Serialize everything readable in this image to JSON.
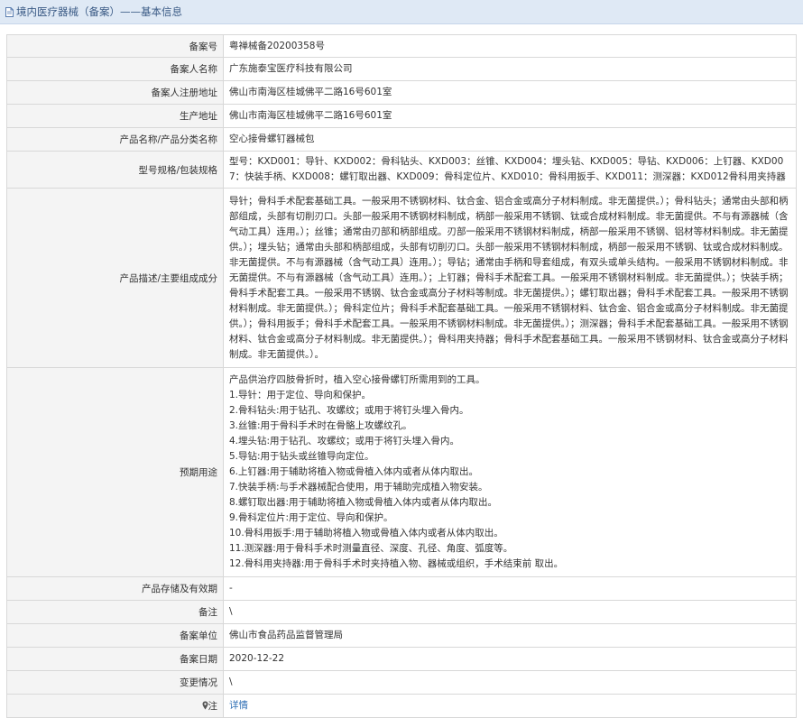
{
  "header": {
    "title": "境内医疗器械（备案）——基本信息",
    "icon": "document-icon"
  },
  "rows": [
    {
      "label": "备案号",
      "value": "粤禅械备20200358号"
    },
    {
      "label": "备案人名称",
      "value": "广东施泰宝医疗科技有限公司"
    },
    {
      "label": "备案人注册地址",
      "value": "佛山市南海区桂城佛平二路16号601室"
    },
    {
      "label": "生产地址",
      "value": "佛山市南海区桂城佛平二路16号601室"
    },
    {
      "label": "产品名称/产品分类名称",
      "value": "空心接骨螺钉器械包"
    },
    {
      "label": "型号规格/包装规格",
      "value": "型号：KXD001：导针、KXD002：骨科钻头、KXD003：丝锥、KXD004：埋头钻、KXD005：导钻、KXD006：上钉器、KXD007：快装手柄、KXD008：螺钉取出器、KXD009：骨科定位片、KXD010：骨科用扳手、KXD011：测深器：KXD012骨科用夹持器"
    },
    {
      "label": "产品描述/主要组成成分",
      "value": "导针；骨科手术配套基础工具。一般采用不锈钢材料、钛合金、铝合金或高分子材料制成。非无菌提供。）；骨科钻头；通常由头部和柄部组成，头部有切削刃口。头部一般采用不锈钢材料制成，柄部一般采用不锈钢、钛或合成材料制成。非无菌提供。不与有源器械（含气动工具）连用。）；丝锥；通常由刃部和柄部组成。刃部一般采用不锈钢材料制成，柄部一般采用不锈钢、铝材等材料制成。非无菌提供。）；埋头钻；通常由头部和柄部组成，头部有切削刃口。头部一般采用不锈钢材料制成，柄部一般采用不锈钢、钛或合成材料制成。非无菌提供。不与有源器械（含气动工具）连用。）；导钻；通常由手柄和导套组成，有双头或单头结构。一般采用不锈钢材料制成。非无菌提供。不与有源器械（含气动工具）连用。）；上钉器；骨科手术配套工具。一般采用不锈钢材料制成。非无菌提供。）；快装手柄；骨科手术配套工具。一般采用不锈钢、钛合金或高分子材料等制成。非无菌提供。）；螺钉取出器；骨科手术配套工具。一般采用不锈钢材料制成。非无菌提供。）；骨科定位片；骨科手术配套基础工具。一般采用不锈钢材料、钛合金、铝合金或高分子材料制成。非无菌提供。）；骨科用扳手；骨科手术配套工具。一般采用不锈钢材料制成。非无菌提供。）；测深器；骨科手术配套基础工具。一般采用不锈钢材料、钛合金或高分子材料制成。非无菌提供。）；骨科用夹持器；骨科手术配套基础工具。一般采用不锈钢材料、钛合金或高分子材料制成。非无菌提供。）。"
    },
    {
      "label": "预期用途",
      "lines": [
        "产品供治疗四肢骨折时，植入空心接骨螺钉所需用到的工具。",
        "1.导针：用于定位、导向和保护。",
        "2.骨科钻头:用于钻孔、攻螺纹；或用于将钉头埋入骨内。",
        "3.丝锥:用于骨科手术时在骨骼上攻螺纹孔。",
        "4.埋头钻:用于钻孔、攻螺纹；或用于将钉头埋入骨内。",
        "5.导钻:用于钻头或丝锥导向定位。",
        "6.上钉器:用于辅助将植入物或骨植入体内或者从体内取出。",
        "7.快装手柄:与手术器械配合使用，用于辅助完成植入物安装。",
        "8.螺钉取出器:用于辅助将植入物或骨植入体内或者从体内取出。",
        "9.骨科定位片:用于定位、导向和保护。",
        "10.骨科用扳手:用于辅助将植入物或骨植入体内或者从体内取出。",
        "11.测深器:用于骨科手术时测量直径、深度、孔径、角度、弧度等。",
        "12.骨科用夹持器:用于骨科手术时夹持植入物、器械或组织，手术结束前 取出。"
      ]
    },
    {
      "label": "产品存储及有效期",
      "value": "-"
    },
    {
      "label": "备注",
      "value": "\\"
    },
    {
      "label": "备案单位",
      "value": "佛山市食品药品监督管理局"
    },
    {
      "label": "备案日期",
      "value": "2020-12-22"
    },
    {
      "label": "变更情况",
      "value": "\\"
    },
    {
      "label": "注",
      "value": "详情",
      "icon": "pin-icon"
    }
  ]
}
